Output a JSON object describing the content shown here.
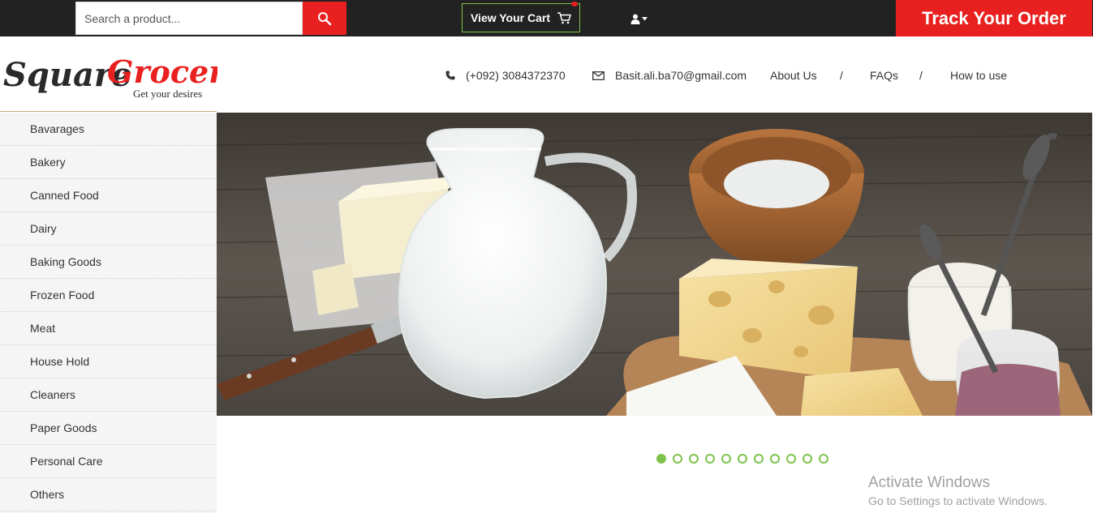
{
  "topbar": {
    "search_placeholder": "Search a product...",
    "search_icon": "search-icon",
    "cart_label": "View Your Cart",
    "cart_icon": "shopping-cart-icon",
    "user_icon": "user-icon",
    "track_label": "Track Your Order"
  },
  "brand": {
    "word1": "Square",
    "word2": "Grocery",
    "tagline": "Get your desires"
  },
  "header": {
    "phone": "(+092) 3084372370",
    "email": "Basit.ali.ba70@gmail.com",
    "nav": [
      "About Us",
      "FAQs",
      "How to use"
    ],
    "separator": "/"
  },
  "categories": [
    "Bavarages",
    "Bakery",
    "Canned Food",
    "Dairy",
    "Baking Goods",
    "Frozen Food",
    "Meat",
    "House Hold",
    "Cleaners",
    "Paper Goods",
    "Personal Care",
    "Others"
  ],
  "slider": {
    "slide_count": 11,
    "active_index": 0
  },
  "watermark": {
    "title": "Activate Windows",
    "subtitle": "Go to Settings to activate Windows."
  },
  "colors": {
    "accent_red": "#e8201f",
    "accent_green": "#7dc24b",
    "topbar_bg": "#222222"
  }
}
